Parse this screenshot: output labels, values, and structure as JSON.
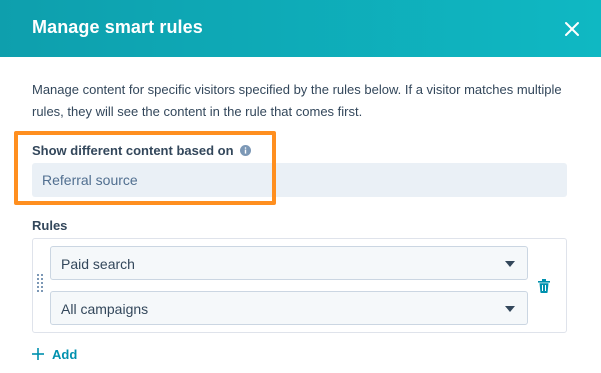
{
  "header": {
    "title": "Manage smart rules",
    "close_icon": "close-icon"
  },
  "description": "Manage content for specific visitors specified by the rules below. If a visitor matches multiple rules, they will see the content in the rule that comes first.",
  "content_based_on": {
    "label": "Show different content based on",
    "info_icon": "info-icon",
    "value": "Referral source"
  },
  "rules": {
    "label": "Rules",
    "items": [
      {
        "primary_select": "Paid search",
        "secondary_select": "All campaigns"
      }
    ],
    "add_label": "Add"
  },
  "colors": {
    "header": "#0fb8c3",
    "highlight": "#ff8f1f",
    "link": "#0091ae",
    "field_bg": "#eaf0f6"
  }
}
